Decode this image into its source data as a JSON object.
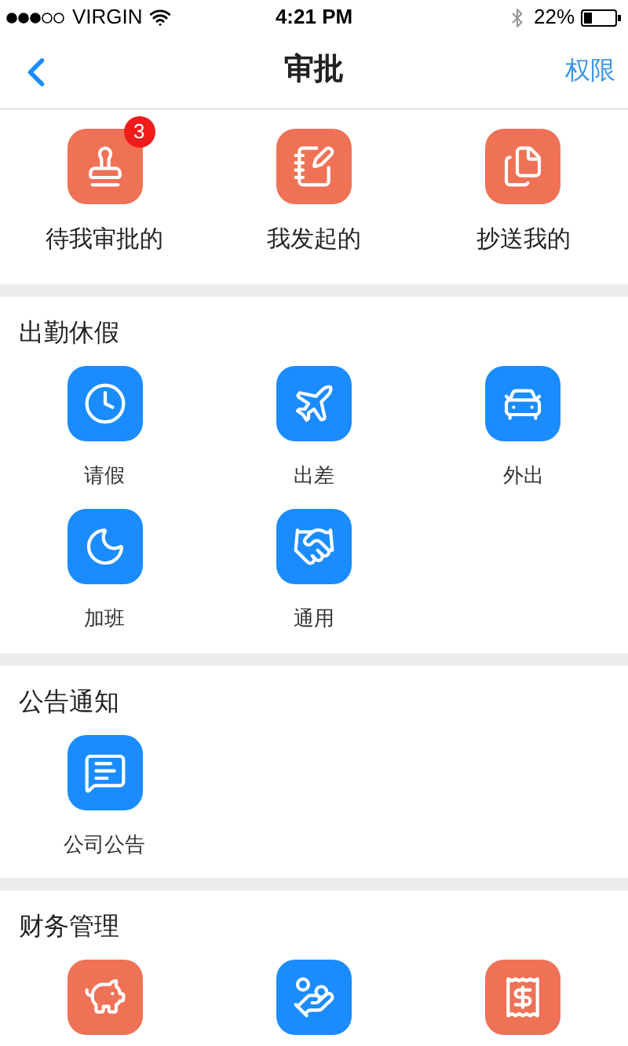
{
  "status_bar": {
    "carrier": "VIRGIN",
    "time": "4:21 PM",
    "battery": "22%"
  },
  "nav": {
    "title": "审批",
    "action": "权限"
  },
  "quick_actions": [
    {
      "label": "待我审批的",
      "badge": "3"
    },
    {
      "label": "我发起的"
    },
    {
      "label": "抄送我的"
    }
  ],
  "sections": [
    {
      "title": "出勤休假",
      "items": [
        {
          "label": "请假"
        },
        {
          "label": "出差"
        },
        {
          "label": "外出"
        },
        {
          "label": "加班"
        },
        {
          "label": "通用"
        }
      ]
    },
    {
      "title": "公告通知",
      "items": [
        {
          "label": "公司公告"
        }
      ]
    },
    {
      "title": "财务管理",
      "items": [
        {
          "color": "#ef7257"
        },
        {
          "color": "#1a8cff"
        },
        {
          "color": "#ef7257"
        }
      ]
    }
  ]
}
